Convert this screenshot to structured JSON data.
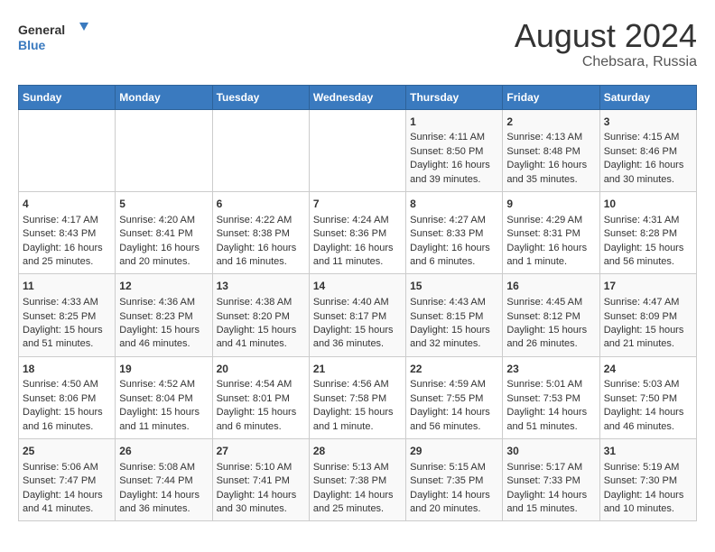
{
  "logo": {
    "line1": "General",
    "line2": "Blue"
  },
  "title": "August 2024",
  "location": "Chebsara, Russia",
  "headers": [
    "Sunday",
    "Monday",
    "Tuesday",
    "Wednesday",
    "Thursday",
    "Friday",
    "Saturday"
  ],
  "weeks": [
    [
      {
        "day": "",
        "sunrise": "",
        "sunset": "",
        "daylight": ""
      },
      {
        "day": "",
        "sunrise": "",
        "sunset": "",
        "daylight": ""
      },
      {
        "day": "",
        "sunrise": "",
        "sunset": "",
        "daylight": ""
      },
      {
        "day": "",
        "sunrise": "",
        "sunset": "",
        "daylight": ""
      },
      {
        "day": "1",
        "sunrise": "Sunrise: 4:11 AM",
        "sunset": "Sunset: 8:50 PM",
        "daylight": "Daylight: 16 hours and 39 minutes."
      },
      {
        "day": "2",
        "sunrise": "Sunrise: 4:13 AM",
        "sunset": "Sunset: 8:48 PM",
        "daylight": "Daylight: 16 hours and 35 minutes."
      },
      {
        "day": "3",
        "sunrise": "Sunrise: 4:15 AM",
        "sunset": "Sunset: 8:46 PM",
        "daylight": "Daylight: 16 hours and 30 minutes."
      }
    ],
    [
      {
        "day": "4",
        "sunrise": "Sunrise: 4:17 AM",
        "sunset": "Sunset: 8:43 PM",
        "daylight": "Daylight: 16 hours and 25 minutes."
      },
      {
        "day": "5",
        "sunrise": "Sunrise: 4:20 AM",
        "sunset": "Sunset: 8:41 PM",
        "daylight": "Daylight: 16 hours and 20 minutes."
      },
      {
        "day": "6",
        "sunrise": "Sunrise: 4:22 AM",
        "sunset": "Sunset: 8:38 PM",
        "daylight": "Daylight: 16 hours and 16 minutes."
      },
      {
        "day": "7",
        "sunrise": "Sunrise: 4:24 AM",
        "sunset": "Sunset: 8:36 PM",
        "daylight": "Daylight: 16 hours and 11 minutes."
      },
      {
        "day": "8",
        "sunrise": "Sunrise: 4:27 AM",
        "sunset": "Sunset: 8:33 PM",
        "daylight": "Daylight: 16 hours and 6 minutes."
      },
      {
        "day": "9",
        "sunrise": "Sunrise: 4:29 AM",
        "sunset": "Sunset: 8:31 PM",
        "daylight": "Daylight: 16 hours and 1 minute."
      },
      {
        "day": "10",
        "sunrise": "Sunrise: 4:31 AM",
        "sunset": "Sunset: 8:28 PM",
        "daylight": "Daylight: 15 hours and 56 minutes."
      }
    ],
    [
      {
        "day": "11",
        "sunrise": "Sunrise: 4:33 AM",
        "sunset": "Sunset: 8:25 PM",
        "daylight": "Daylight: 15 hours and 51 minutes."
      },
      {
        "day": "12",
        "sunrise": "Sunrise: 4:36 AM",
        "sunset": "Sunset: 8:23 PM",
        "daylight": "Daylight: 15 hours and 46 minutes."
      },
      {
        "day": "13",
        "sunrise": "Sunrise: 4:38 AM",
        "sunset": "Sunset: 8:20 PM",
        "daylight": "Daylight: 15 hours and 41 minutes."
      },
      {
        "day": "14",
        "sunrise": "Sunrise: 4:40 AM",
        "sunset": "Sunset: 8:17 PM",
        "daylight": "Daylight: 15 hours and 36 minutes."
      },
      {
        "day": "15",
        "sunrise": "Sunrise: 4:43 AM",
        "sunset": "Sunset: 8:15 PM",
        "daylight": "Daylight: 15 hours and 32 minutes."
      },
      {
        "day": "16",
        "sunrise": "Sunrise: 4:45 AM",
        "sunset": "Sunset: 8:12 PM",
        "daylight": "Daylight: 15 hours and 26 minutes."
      },
      {
        "day": "17",
        "sunrise": "Sunrise: 4:47 AM",
        "sunset": "Sunset: 8:09 PM",
        "daylight": "Daylight: 15 hours and 21 minutes."
      }
    ],
    [
      {
        "day": "18",
        "sunrise": "Sunrise: 4:50 AM",
        "sunset": "Sunset: 8:06 PM",
        "daylight": "Daylight: 15 hours and 16 minutes."
      },
      {
        "day": "19",
        "sunrise": "Sunrise: 4:52 AM",
        "sunset": "Sunset: 8:04 PM",
        "daylight": "Daylight: 15 hours and 11 minutes."
      },
      {
        "day": "20",
        "sunrise": "Sunrise: 4:54 AM",
        "sunset": "Sunset: 8:01 PM",
        "daylight": "Daylight: 15 hours and 6 minutes."
      },
      {
        "day": "21",
        "sunrise": "Sunrise: 4:56 AM",
        "sunset": "Sunset: 7:58 PM",
        "daylight": "Daylight: 15 hours and 1 minute."
      },
      {
        "day": "22",
        "sunrise": "Sunrise: 4:59 AM",
        "sunset": "Sunset: 7:55 PM",
        "daylight": "Daylight: 14 hours and 56 minutes."
      },
      {
        "day": "23",
        "sunrise": "Sunrise: 5:01 AM",
        "sunset": "Sunset: 7:53 PM",
        "daylight": "Daylight: 14 hours and 51 minutes."
      },
      {
        "day": "24",
        "sunrise": "Sunrise: 5:03 AM",
        "sunset": "Sunset: 7:50 PM",
        "daylight": "Daylight: 14 hours and 46 minutes."
      }
    ],
    [
      {
        "day": "25",
        "sunrise": "Sunrise: 5:06 AM",
        "sunset": "Sunset: 7:47 PM",
        "daylight": "Daylight: 14 hours and 41 minutes."
      },
      {
        "day": "26",
        "sunrise": "Sunrise: 5:08 AM",
        "sunset": "Sunset: 7:44 PM",
        "daylight": "Daylight: 14 hours and 36 minutes."
      },
      {
        "day": "27",
        "sunrise": "Sunrise: 5:10 AM",
        "sunset": "Sunset: 7:41 PM",
        "daylight": "Daylight: 14 hours and 30 minutes."
      },
      {
        "day": "28",
        "sunrise": "Sunrise: 5:13 AM",
        "sunset": "Sunset: 7:38 PM",
        "daylight": "Daylight: 14 hours and 25 minutes."
      },
      {
        "day": "29",
        "sunrise": "Sunrise: 5:15 AM",
        "sunset": "Sunset: 7:35 PM",
        "daylight": "Daylight: 14 hours and 20 minutes."
      },
      {
        "day": "30",
        "sunrise": "Sunrise: 5:17 AM",
        "sunset": "Sunset: 7:33 PM",
        "daylight": "Daylight: 14 hours and 15 minutes."
      },
      {
        "day": "31",
        "sunrise": "Sunrise: 5:19 AM",
        "sunset": "Sunset: 7:30 PM",
        "daylight": "Daylight: 14 hours and 10 minutes."
      }
    ]
  ]
}
